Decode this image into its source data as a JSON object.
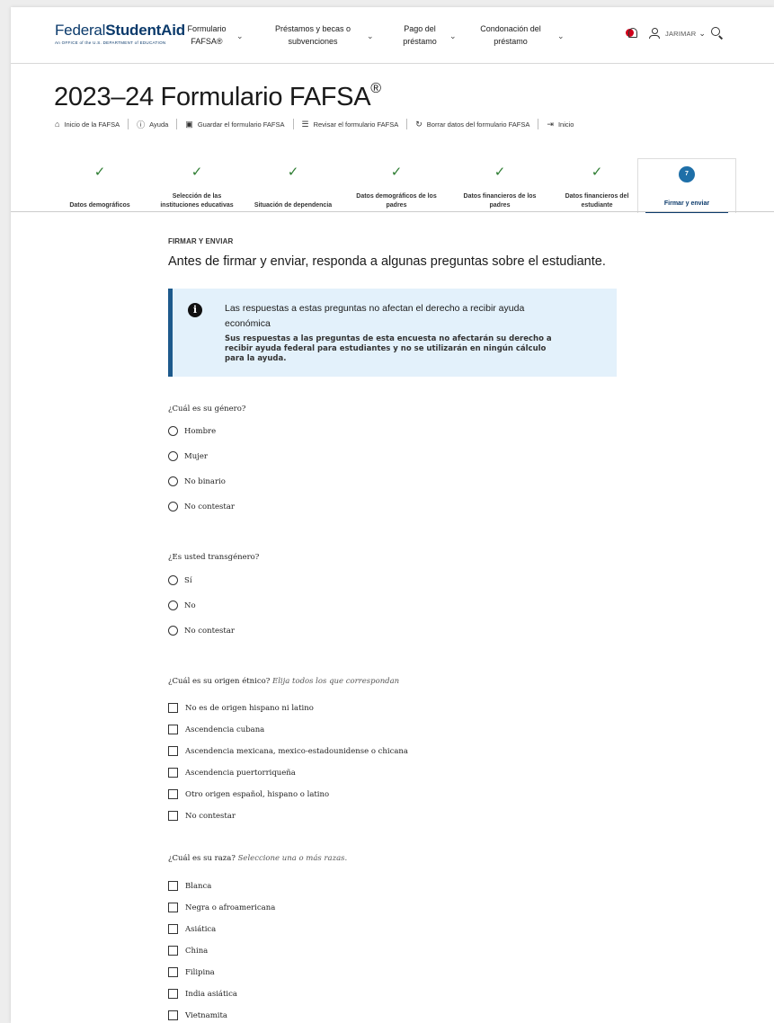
{
  "header": {
    "logo_main_a": "Federal",
    "logo_main_b": "Student",
    "logo_main_c": "Aid",
    "logo_sub": "An OFFICE of the U.S. DEPARTMENT of EDUCATION",
    "nav": [
      {
        "line1": "Formulario",
        "line2": "FAFSA®"
      },
      {
        "line1": "Préstamos y becas o",
        "line2": "subvenciones"
      },
      {
        "line1": "Pago del",
        "line2": "préstamo"
      },
      {
        "line1": "Condonación del",
        "line2": "préstamo"
      }
    ],
    "user_name": "JARIMAR"
  },
  "title": "2023–24 Formulario FAFSA",
  "title_sup": "®",
  "toolbar": [
    {
      "icon": "home-icon",
      "label": "Inicio de la FAFSA"
    },
    {
      "icon": "help-icon",
      "label": "Ayuda"
    },
    {
      "icon": "save-icon",
      "label": "Guardar el formulario FAFSA"
    },
    {
      "icon": "list-icon",
      "label": "Revisar el formulario FAFSA"
    },
    {
      "icon": "reset-icon",
      "label": "Borrar datos del formulario FAFSA"
    },
    {
      "icon": "logout-icon",
      "label": "Inicio"
    }
  ],
  "steps": [
    {
      "line1": "",
      "line2": "Datos demográficos",
      "done": true
    },
    {
      "line1": "Selección de las",
      "line2": "instituciones educativas",
      "done": true
    },
    {
      "line1": "",
      "line2": "Situación de dependencia",
      "done": true
    },
    {
      "line1": "Datos demográficos de los",
      "line2": "padres",
      "done": true
    },
    {
      "line1": "Datos financieros de los",
      "line2": "padres",
      "done": true
    },
    {
      "line1": "Datos financieros del",
      "line2": "estudiante",
      "done": true
    },
    {
      "number": "7",
      "line1": "",
      "line2": "Firmar y enviar",
      "done": false,
      "active": true
    }
  ],
  "section_label": "FIRMAR Y ENVIAR",
  "section_heading": "Antes de firmar y enviar, responda a algunas preguntas sobre el estudiante.",
  "info": {
    "title": "Las respuestas a estas preguntas no afectan el derecho a recibir ayuda económica",
    "body": "Sus respuestas a las preguntas de esta encuesta no afectarán su derecho a recibir ayuda federal para estudiantes y no se utilizarán en ningún cálculo para la ayuda."
  },
  "q_gender": {
    "label": "¿Cuál es su género?",
    "options": [
      "Hombre",
      "Mujer",
      "No binario",
      "No contestar"
    ]
  },
  "q_trans": {
    "label": "¿Es usted transgénero?",
    "options": [
      "Sí",
      "No",
      "No contestar"
    ]
  },
  "q_ethnic": {
    "label": "¿Cuál es su origen étnico?",
    "hint": "Elija todos los que correspondan",
    "options": [
      "No es de origen hispano ni latino",
      "Ascendencia cubana",
      "Ascendencia mexicana, mexico-estadounidense o chicana",
      "Ascendencia puertorriqueña",
      "Otro origen español, hispano o latino",
      "No contestar"
    ]
  },
  "q_race": {
    "label": "¿Cuál es su raza?",
    "hint": "Seleccione una o más razas.",
    "options": [
      "Blanca",
      "Negra o afroamericana",
      "Asiática",
      "China",
      "Filipina",
      "India asiática",
      "Vietnamita"
    ]
  }
}
